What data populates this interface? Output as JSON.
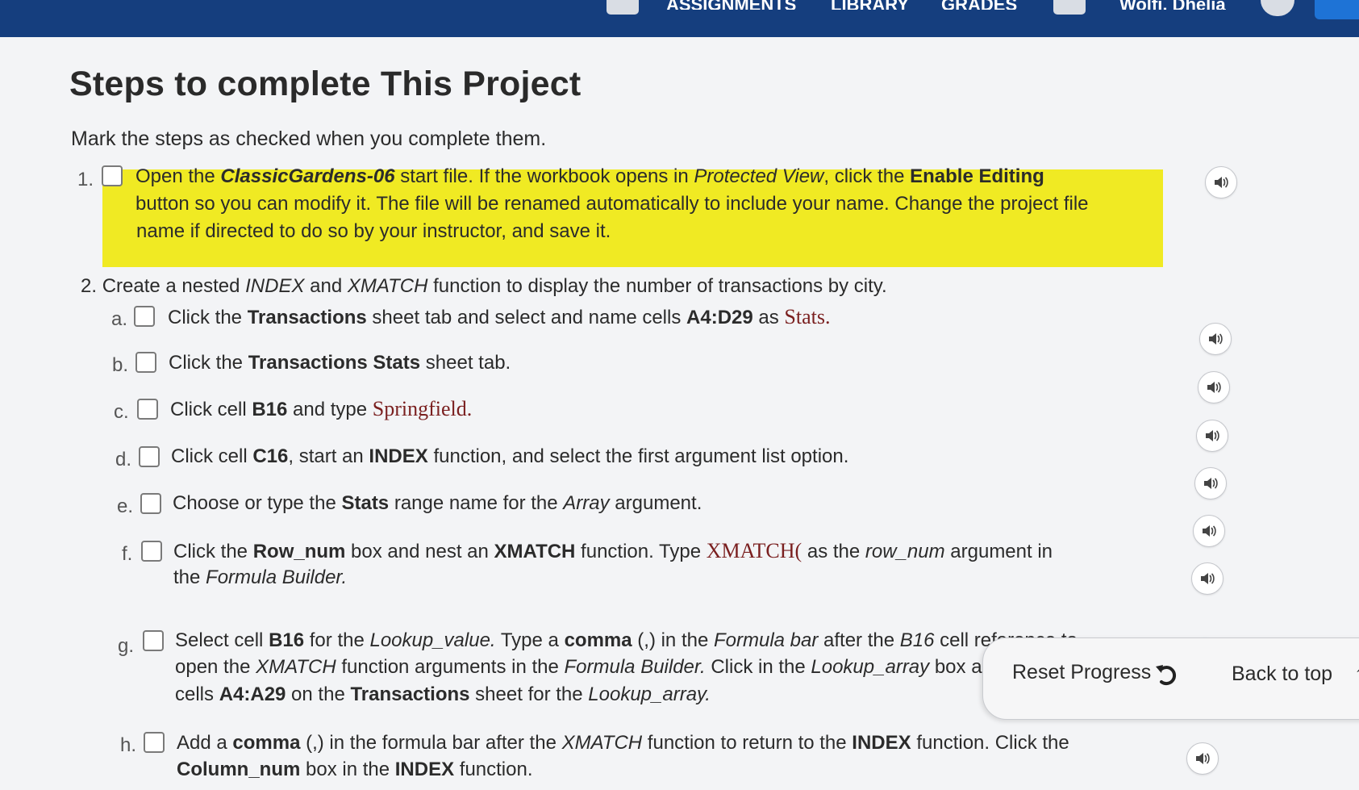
{
  "header": {
    "nav": [
      "ASSIGNMENTS",
      "LIBRARY",
      "GRADES"
    ],
    "user": "Wolfi, Dhelia"
  },
  "title": "Steps to complete This Project",
  "intro": "Mark the steps as checked when you complete them.",
  "steps": {
    "s1": {
      "num": "1.",
      "p1": "Open the ",
      "file": "ClassicGardens-06",
      "p2": " start file. If the workbook opens in ",
      "pv": "Protected View",
      "p3": ", click the ",
      "enable": "Enable Editing",
      "line2": "button so you can modify it. The file will be renamed automatically to include your name. Change the project file",
      "line3": "name if directed to do so by your instructor, and save it."
    },
    "s2": {
      "num": "2.",
      "p1": "Create a nested ",
      "index": "INDEX",
      "p2": " and ",
      "xmatch": "XMATCH",
      "p3": " function to display the number of transactions by city."
    },
    "a": {
      "letter": "a.",
      "p1": "Click the ",
      "b1": "Transactions",
      "p2": " sheet tab and select and name cells ",
      "b2": "A4:D29",
      "p3": " as ",
      "serif": "Stats."
    },
    "b": {
      "letter": "b.",
      "p1": "Click the ",
      "b1": "Transactions Stats",
      "p2": " sheet tab."
    },
    "c": {
      "letter": "c.",
      "p1": "Click cell ",
      "b1": "B16",
      "p2": " and type ",
      "serif": "Springfield."
    },
    "d": {
      "letter": "d.",
      "p1": "Click cell ",
      "b1": "C16",
      "p2": ", start an ",
      "b2": "INDEX",
      "p3": " function, and select the first argument list option."
    },
    "e": {
      "letter": "e.",
      "p1": "Choose or type the ",
      "b1": "Stats",
      "p2": " range name for the ",
      "i1": "Array",
      "p3": " argument."
    },
    "f": {
      "letter": "f.",
      "p1": "Click the ",
      "b1": "Row_num",
      "p2": " box and nest an ",
      "b2": "XMATCH",
      "p3": " function. Type ",
      "serif": "XMATCH(",
      "p4": " as the ",
      "i1": "row_num",
      "p5": " argument in",
      "l2a": "the ",
      "l2i": "Formula Builder."
    },
    "g": {
      "letter": "g.",
      "p1": "Select cell ",
      "b1": "B16",
      "p2": " for the ",
      "i1": "Lookup_value.",
      "p3": " Type a ",
      "b2": "comma",
      "p4": " (,) in the ",
      "i2": "Formula bar",
      "p5": " after the ",
      "i3": "B16",
      "p6": " cell reference to",
      "l2a": "open the ",
      "l2i1": "XMATCH",
      "l2b": " function arguments in the ",
      "l2i2": "Formula Builder.",
      "l2c": " Click in the ",
      "l2i3": "Lookup_array",
      "l2d": " box and select",
      "l3a": "cells ",
      "l3b1": "A4:A29",
      "l3b": " on the ",
      "l3b2": "Transactions",
      "l3c": " sheet for the ",
      "l3i": "Lookup_array."
    },
    "h": {
      "letter": "h.",
      "p1": "Add a ",
      "b1": "comma",
      "p2": " (,) in the formula bar after the ",
      "i1": "XMATCH",
      "p3": " function to return to the ",
      "b2": "INDEX",
      "p4": " function. Click the",
      "l2b": "Column_num",
      "l2a": " box in the ",
      "l2b2": "INDEX",
      "l2c": " function."
    }
  },
  "footer": {
    "reset_label": "Reset Progress",
    "back_to_top": "Back to top"
  },
  "icons": {
    "speaker": "speaker-icon",
    "reset": "reset-icon",
    "back_to_top": "arrow-up-icon"
  },
  "colors": {
    "highlight": "#f0ea23",
    "header": "#153e7e",
    "serif_text": "#7a1f1f"
  }
}
